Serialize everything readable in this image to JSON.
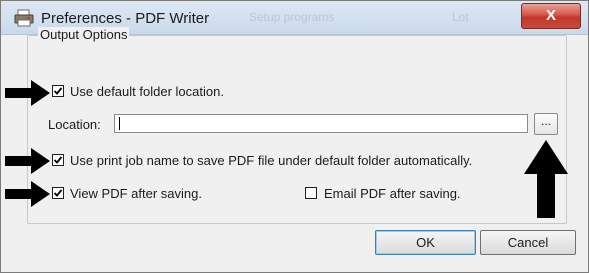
{
  "window": {
    "title": "Preferences - PDF Writer",
    "close_label": "X",
    "background_title_fragments": [
      "Setup programs",
      "Lot"
    ]
  },
  "group": {
    "label": "Output Options"
  },
  "options": {
    "use_default_folder": {
      "label": "Use default folder location.",
      "checked": true
    },
    "use_print_job_name": {
      "label": "Use print job name to save PDF file under default folder automatically.",
      "checked": true
    },
    "view_pdf": {
      "label": "View PDF after saving.",
      "checked": true
    },
    "email_pdf": {
      "label": "Email PDF after saving.",
      "checked": false
    }
  },
  "location": {
    "label": "Location:",
    "value": "",
    "browse_label": "..."
  },
  "buttons": {
    "ok": "OK",
    "cancel": "Cancel"
  },
  "annotations": {
    "arrow_color": "#000000",
    "arrow_count": 4
  },
  "colors": {
    "close_button": "#c0392b",
    "window_bg": "#f0f0f0",
    "titlebar": "#c9d9ec"
  }
}
